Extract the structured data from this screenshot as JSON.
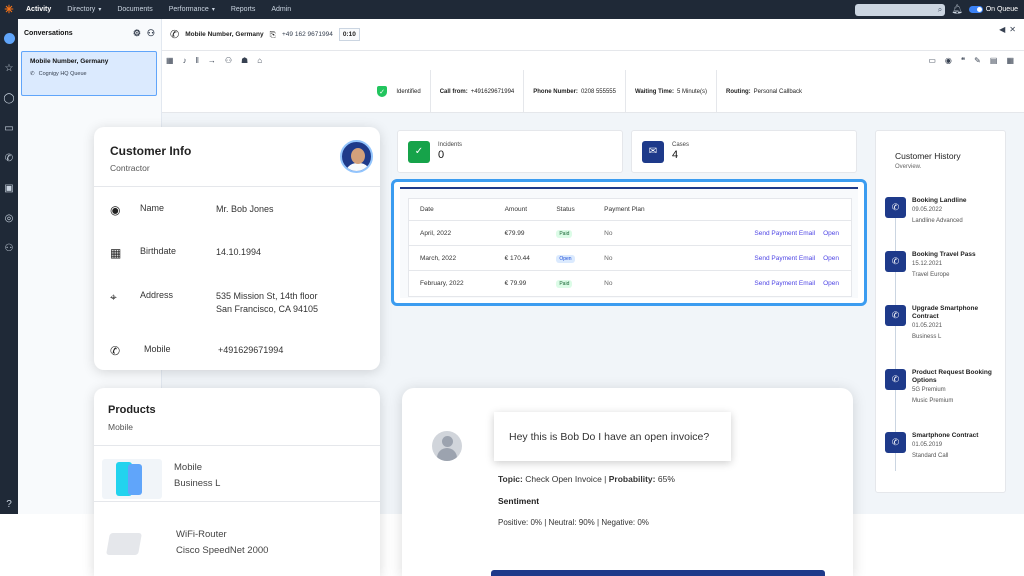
{
  "topbar": {
    "nav": [
      {
        "label": "Activity",
        "active": true,
        "caret": false
      },
      {
        "label": "Directory",
        "active": false,
        "caret": true
      },
      {
        "label": "Documents",
        "active": false,
        "caret": false
      },
      {
        "label": "Performance",
        "active": false,
        "caret": true
      },
      {
        "label": "Reports",
        "active": false,
        "caret": false
      },
      {
        "label": "Admin",
        "active": false,
        "caret": false
      }
    ],
    "status_label": "On Queue"
  },
  "conversations": {
    "title": "Conversations",
    "card": {
      "title": "Mobile Number, Germany",
      "subtitle": "Cognigy HQ Queue"
    }
  },
  "call": {
    "title": "Mobile Number, Germany",
    "number": "+49 162 9671994",
    "timer": "0:10"
  },
  "info_strip": {
    "identified": "Identified",
    "call_from_label": "Call from:",
    "call_from": "+491629671994",
    "phone_label": "Phone Number:",
    "phone": "0208 555555",
    "waiting_label": "Waiting Time:",
    "waiting": "5 Minute(s)",
    "routing_label": "Routing:",
    "routing": "Personal Callback"
  },
  "customer": {
    "title": "Customer Info",
    "subtitle": "Contractor",
    "name_label": "Name",
    "name": "Mr. Bob Jones",
    "birthdate_label": "Birthdate",
    "birthdate": "14.10.1994",
    "address_label": "Address",
    "address_line1": "535 Mission St, 14th floor",
    "address_line2": "San Francisco, CA 94105",
    "mobile_label": "Mobile",
    "mobile": "+491629671994"
  },
  "products": {
    "title": "Products",
    "subtitle": "Mobile",
    "items": [
      {
        "name": "Mobile",
        "detail": "Business L"
      },
      {
        "name": "WiFi-Router",
        "detail": "Cisco SpeedNet 2000"
      }
    ]
  },
  "stats": {
    "incidents_label": "Incidents",
    "incidents": "0",
    "cases_label": "Cases",
    "cases": "4"
  },
  "payments": {
    "headers": [
      "Date",
      "Amount",
      "Status",
      "Payment Plan"
    ],
    "rows": [
      {
        "date": "April, 2022",
        "amount": "€79.99",
        "status": "Paid",
        "plan": "No",
        "action": "Send Payment Email",
        "open": "Open"
      },
      {
        "date": "March, 2022",
        "amount": "€ 170.44",
        "status": "Open",
        "plan": "No",
        "action": "Send Payment Email",
        "open": "Open"
      },
      {
        "date": "February, 2022",
        "amount": "€ 79.99",
        "status": "Paid",
        "plan": "No",
        "action": "Send Payment Email",
        "open": "Open"
      }
    ]
  },
  "chat": {
    "message": "Hey this is Bob Do I have an open invoice?",
    "topic_label": "Topic:",
    "topic": "Check Open Invoice",
    "probability_label": "Probability:",
    "probability": "65%",
    "sentiment_label": "Sentiment",
    "sentiment": "Positive: 0% | Neutral: 90% | Negative: 0%"
  },
  "history": {
    "title": "Customer History",
    "subtitle": "Overview.",
    "items": [
      {
        "title": "Booking Landline",
        "date": "09.05.2022",
        "detail": "Landline Advanced"
      },
      {
        "title": "Booking Travel Pass",
        "date": "15.12.2021",
        "detail": "Travel Europe"
      },
      {
        "title": "Upgrade Smartphone Contract",
        "date": "01.05.2021",
        "detail": "Business L"
      },
      {
        "title": "Product Request Booking Options",
        "date": "5G Premium",
        "detail": "Music Premium"
      },
      {
        "title": "Smartphone Contract",
        "date": "01.05.2019",
        "detail": "Standard Call"
      }
    ]
  },
  "colors": {
    "accent": "#1e3a8a",
    "highlight": "#3b9cf0",
    "topbar": "#1f2937"
  }
}
